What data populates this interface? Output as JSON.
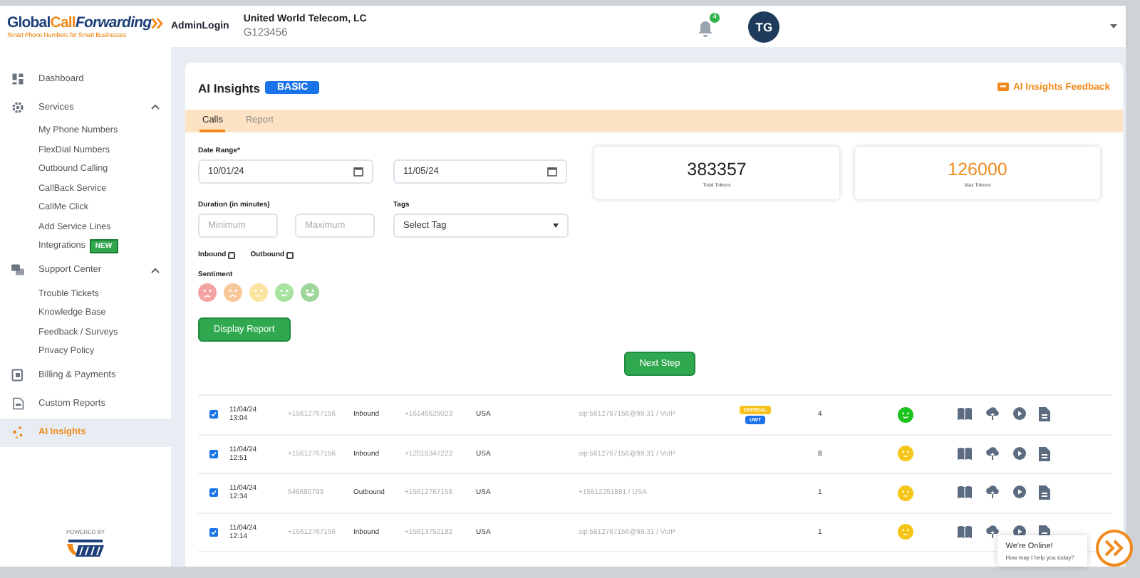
{
  "header": {
    "logo": {
      "words": [
        "Global",
        "Call",
        "Forwarding"
      ],
      "tagline": "Smart Phone Numbers for Smart Businesses"
    },
    "user_label": "AdminLogin",
    "company": "United World Telecom, LC",
    "account": "G123456",
    "notification_count": "4",
    "avatar": "TG"
  },
  "sidebar": {
    "items": [
      {
        "label": "Dashboard",
        "selected": false
      },
      {
        "label": "Services",
        "selected": false,
        "expanded": true,
        "children": [
          {
            "label": "My Phone Numbers"
          },
          {
            "label": "FlexDial Numbers"
          },
          {
            "label": "Outbound Calling"
          },
          {
            "label": "CallBack Service"
          },
          {
            "label": "CallMe Click"
          },
          {
            "label": "Add Service Lines"
          },
          {
            "label": "Integrations",
            "badge": "NEW"
          }
        ]
      },
      {
        "label": "Support Center",
        "selected": false,
        "expanded": true,
        "children": [
          {
            "label": "Trouble Tickets"
          },
          {
            "label": "Knowledge Base"
          },
          {
            "label": "Feedback / Surveys"
          },
          {
            "label": "Privacy Policy"
          }
        ]
      },
      {
        "label": "Billing & Payments",
        "selected": false
      },
      {
        "label": "Custom Reports",
        "selected": false
      },
      {
        "label": "AI Insights",
        "selected": true
      }
    ],
    "powered_by": "POWERED BY"
  },
  "page": {
    "title": "AI Insights",
    "plan": "BASIC",
    "feedback_link": "AI Insights Feedback",
    "tabs": [
      {
        "label": "Calls",
        "selected": true
      },
      {
        "label": "Report",
        "selected": false
      }
    ],
    "filters": {
      "date_range_label": "Date Range*",
      "date_from": "10/01/24",
      "date_to": "11/05/24",
      "duration_label": "Duration (in minutes)",
      "min_placeholder": "Minimum",
      "max_placeholder": "Maximum",
      "tags_label": "Tags",
      "tags_value": "Select Tag",
      "direction": [
        {
          "label": "Inbound",
          "checked": false
        },
        {
          "label": "Outbound",
          "checked": false
        }
      ],
      "sentiment_label": "Sentiment",
      "sentiments": [
        {
          "kind": "angry",
          "color": "#f4a3a3"
        },
        {
          "kind": "sad",
          "color": "#f8c89a"
        },
        {
          "kind": "neutral",
          "color": "#fbe3a0"
        },
        {
          "kind": "smile",
          "color": "#a8e3a0"
        },
        {
          "kind": "grin",
          "color": "#9fd69a"
        }
      ],
      "display_button": "Display Report"
    },
    "stats": [
      {
        "value": "383357",
        "label": "Total Tokens",
        "kind": "total"
      },
      {
        "value": "126000",
        "label": "Max Tokens",
        "kind": "max"
      }
    ],
    "next_button": "Next Step",
    "rows": [
      {
        "checked": true,
        "date": "11/04/24",
        "time": "13:04",
        "from": "+15612767156",
        "direction": "Inbound",
        "to": "+16145629023",
        "country": "USA",
        "destination": "sip:5612767156@99.31 / VoIP",
        "tags": [
          {
            "label": "CRITICAL",
            "color": "#f7c21b"
          },
          {
            "label": "UWT",
            "color": "#1a73e8"
          }
        ],
        "count": "4",
        "sentiment": {
          "kind": "smile",
          "color": "#1ec41e"
        }
      },
      {
        "checked": true,
        "date": "11/04/24",
        "time": "12:51",
        "from": "+15612767156",
        "direction": "Inbound",
        "to": "+12015347222",
        "country": "USA",
        "destination": "sip:5612767156@99.31 / VoIP",
        "tags": [],
        "count": "8",
        "sentiment": {
          "kind": "neutral",
          "color": "#f5c518"
        }
      },
      {
        "checked": true,
        "date": "11/04/24",
        "time": "12:34",
        "from": "546680793",
        "direction": "Outbound",
        "to": "+15612767156",
        "country": "USA",
        "destination": "+15512251881 / USA",
        "tags": [],
        "count": "1",
        "sentiment": {
          "kind": "neutral",
          "color": "#f5c518"
        }
      },
      {
        "checked": true,
        "date": "11/04/24",
        "time": "12:14",
        "from": "+15612767156",
        "direction": "Inbound",
        "to": "+15613752182",
        "country": "USA",
        "destination": "sip:5612767156@99.31 / VoIP",
        "tags": [],
        "count": "1",
        "sentiment": {
          "kind": "neutral",
          "color": "#f5c518"
        }
      }
    ]
  },
  "chat": {
    "title": "We're Online!",
    "subtitle": "How may I help you today?"
  }
}
